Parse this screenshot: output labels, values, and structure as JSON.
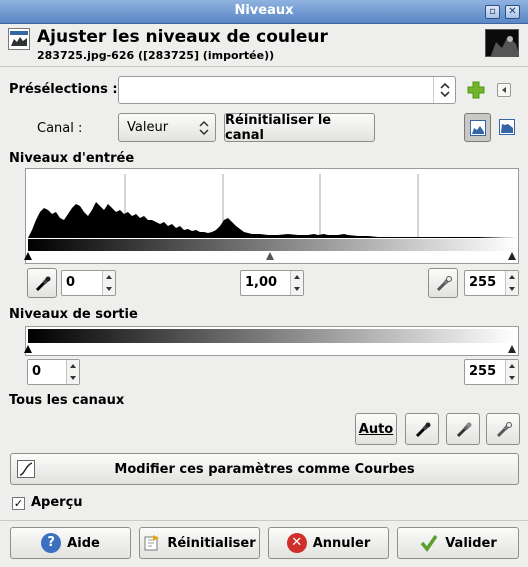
{
  "window": {
    "title": "Niveaux",
    "minimize_glyph": "▫",
    "close_glyph": "✕"
  },
  "header": {
    "title": "Ajuster les niveaux de couleur",
    "subtitle": "283725.jpg-626 ([283725] (importée))"
  },
  "presets": {
    "label": "Présélections :",
    "value": "",
    "add_icon": "plus-icon",
    "menu_icon": "menu-arrow-icon"
  },
  "channel": {
    "label": "Canal :",
    "value": "Valeur",
    "reset_label": "Réinitialiser le canal",
    "linear_icon": "histogram-linear-icon",
    "log_icon": "histogram-log-icon"
  },
  "input_levels": {
    "label": "Niveaux d'entrée",
    "low": "0",
    "gamma": "1,00",
    "high": "255"
  },
  "output_levels": {
    "label": "Niveaux de sortie",
    "low": "0",
    "high": "255"
  },
  "all_channels": {
    "label": "Tous les canaux",
    "auto_label": "Auto"
  },
  "curves_button": {
    "label": "Modifier ces paramètres comme Courbes"
  },
  "preview": {
    "label": "Aperçu",
    "checked": true
  },
  "footer": {
    "help": "Aide",
    "reset": "Réinitialiser",
    "cancel": "Annuler",
    "ok": "Valider"
  },
  "colors": {
    "titlebar": "#5a86c4",
    "help_icon": "#3d6fc0",
    "cancel_icon": "#d0302c",
    "ok_icon": "#5aa02c",
    "add_icon": "#4e9a06"
  }
}
